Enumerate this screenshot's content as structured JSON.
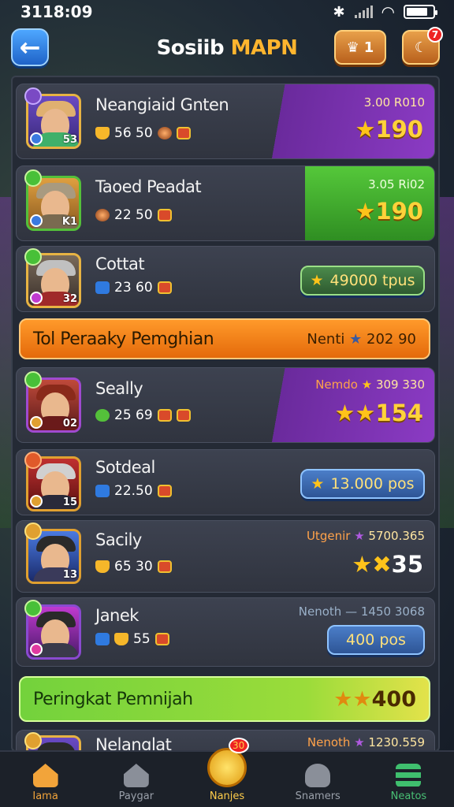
{
  "status_bar": {
    "time": "3118:09"
  },
  "header": {
    "title_a": "Sosiib",
    "title_b": "MAPN",
    "crown_count": "1",
    "bell_badge": "7"
  },
  "rows": [
    {
      "name": "Neangiaid Gnten",
      "stat": "56 50",
      "right_top": "3.00 R010",
      "right_big": "190",
      "level": "53"
    },
    {
      "name": "Taoed Peadat",
      "stat": "22 50",
      "right_top": "3.05 Ri02",
      "right_big": "190",
      "level": "K1"
    },
    {
      "name": "Cottat",
      "stat": "23 60",
      "pill": "49000 tpus",
      "level": "32"
    },
    {
      "name": "Seally",
      "stat": "25 69",
      "right_top_label": "Nemdo",
      "right_top_val": "309 330",
      "right_big": "154",
      "level": "02"
    },
    {
      "name": "Sotdeal",
      "stat": "22.50",
      "pill": "13.000 pos",
      "level": "15"
    },
    {
      "name": "Sacily",
      "stat": "65 30",
      "right_top_label": "Utgenir",
      "right_top_val": "5700.365",
      "right_big": "35",
      "level": "13"
    },
    {
      "name": "Janek",
      "stat": "55",
      "right_top_label": "Nenoth",
      "right_top_val": "— 1450 3068",
      "pill": "400 pos",
      "level": ""
    },
    {
      "name": "Nelanglat",
      "right_top_label": "Nenoth",
      "right_top_val": "1230.559"
    }
  ],
  "banners": {
    "orange": {
      "title": "Tol Peraaky Pemghian",
      "label": "Nenti",
      "value": "202 90"
    },
    "lime": {
      "title": "Peringkat Pemnijah",
      "value": "400"
    }
  },
  "nav": {
    "items": [
      "Iama",
      "Paygar",
      "Nanjes",
      "Snamers",
      "Neatos"
    ],
    "badge": "30"
  }
}
